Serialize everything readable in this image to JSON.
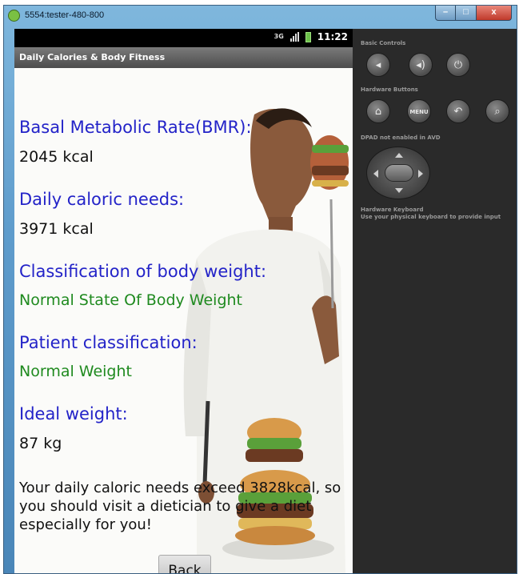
{
  "window": {
    "title": "5554:tester-480-800",
    "minimize_glyph": "–",
    "maximize_glyph": "□",
    "close_glyph": "x"
  },
  "status_bar": {
    "network_label": "3G",
    "time": "11:22"
  },
  "app": {
    "title": "Daily Calories & Body Fitness"
  },
  "results": [
    {
      "label": "Basal Metabolic Rate(BMR):",
      "value": "2045 kcal",
      "value_style": "normal"
    },
    {
      "label": "Daily caloric needs:",
      "value": "3971 kcal",
      "value_style": "normal"
    },
    {
      "label": "Classification of body weight:",
      "value": "Normal State Of Body Weight",
      "value_style": "good"
    },
    {
      "label": "Patient classification:",
      "value": "Normal Weight",
      "value_style": "good"
    },
    {
      "label": "Ideal weight:",
      "value": "87 kg",
      "value_style": "normal"
    }
  ],
  "message": "Your daily caloric needs exceed 3828kcal, so you should visit a dietician to give a diet especially for you!",
  "back_button": {
    "label": "Back"
  },
  "emulator_controls": {
    "basic_controls_label": "Basic Controls",
    "hardware_buttons_label": "Hardware Buttons",
    "menu_label": "MENU",
    "dpad_label": "DPAD not enabled in AVD",
    "keyboard_title": "Hardware Keyboard",
    "keyboard_hint": "Use your physical keyboard to provide input"
  },
  "colors": {
    "label": "#2323c8",
    "good": "#1f8a1f",
    "app_bar": "#5a5a5a",
    "controls_bg": "#2a2a2a"
  },
  "icons": {
    "volume_down": "volume-down-icon",
    "volume_up": "volume-up-icon",
    "power": "power-icon",
    "home": "home-icon",
    "back": "back-arrow-icon",
    "search": "search-icon"
  }
}
